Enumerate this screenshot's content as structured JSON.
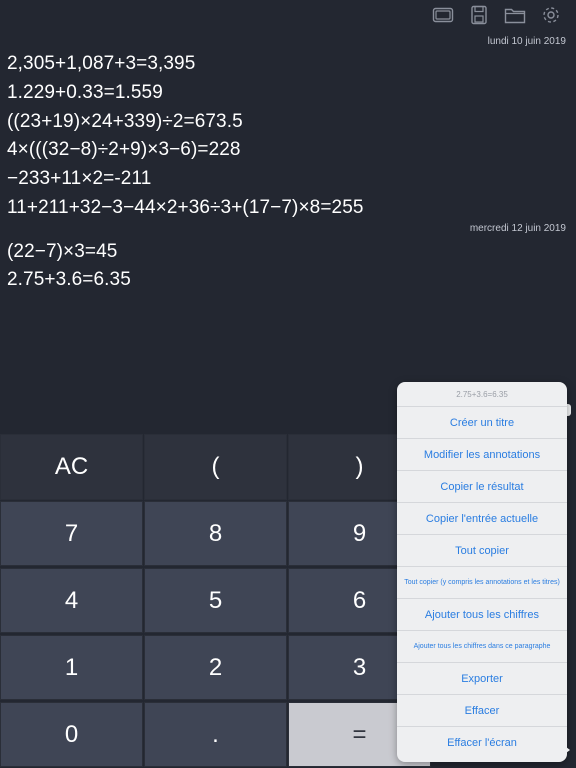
{
  "toolbar": {
    "icons": [
      "screen-icon",
      "save-icon",
      "folder-icon",
      "gear-icon"
    ]
  },
  "history": {
    "groups": [
      {
        "date": "lundi 10 juin 2019",
        "lines": [
          "2,305+1,087+3=3,395",
          "1.229+0.33=1.559",
          "((23+19)×24+339)÷2=673.5",
          "4×(((32−8)÷2+9)×3−6)=228",
          "−233+11×2=-211",
          "11+211+32−3−44×2+36÷3+(17−7)×8=255"
        ]
      },
      {
        "date": "mercredi 12 juin 2019",
        "lines": [
          "(22−7)×3=45",
          "2.75+3.6=6.35"
        ]
      }
    ]
  },
  "keypad": {
    "keys": [
      "AC",
      "(",
      ")",
      "7",
      "8",
      "9",
      "4",
      "5",
      "6",
      "1",
      "2",
      "3",
      "0",
      ".",
      "="
    ]
  },
  "popup": {
    "header": "2.75+3.6=6.35",
    "items": [
      "Créer un titre",
      "Modifier les annotations",
      "Copier le résultat",
      "Copier l'entrée actuelle",
      "Tout copier",
      "Tout copier (y compris les annotations et les titres)",
      "Ajouter tous les chiffres",
      "Ajouter tous les chiffres dans ce paragraphe",
      "Exporter",
      "Effacer",
      "Effacer l'écran"
    ]
  }
}
